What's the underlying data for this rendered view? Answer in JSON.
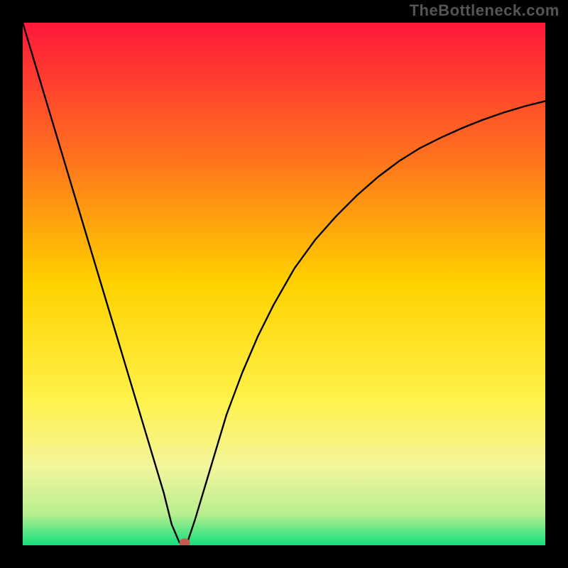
{
  "watermark": "TheBottleneck.com",
  "chart_data": {
    "type": "line",
    "title": "",
    "xlabel": "",
    "ylabel": "",
    "xlim": [
      0,
      100
    ],
    "ylim": [
      0,
      100
    ],
    "x": [
      0,
      3,
      6,
      9,
      12,
      15,
      18,
      21,
      24,
      27,
      28.5,
      30,
      31.5,
      33,
      36,
      39,
      42,
      45,
      48,
      52,
      56,
      60,
      64,
      68,
      72,
      76,
      80,
      84,
      88,
      92,
      96,
      100
    ],
    "values": [
      100,
      90,
      80,
      70,
      60,
      50,
      40,
      30,
      20,
      10,
      4,
      0.5,
      0.5,
      5,
      15,
      25,
      33,
      40,
      46,
      53,
      58.5,
      63,
      67,
      70.5,
      73.5,
      76,
      78,
      79.8,
      81.4,
      82.8,
      84,
      85
    ],
    "marker": {
      "x": 31,
      "y": 0.5
    },
    "background_gradient": {
      "stops": [
        {
          "offset": 0.0,
          "color": "#ff183b"
        },
        {
          "offset": 0.25,
          "color": "#ff6f1f"
        },
        {
          "offset": 0.5,
          "color": "#ffd200"
        },
        {
          "offset": 0.72,
          "color": "#fff24a"
        },
        {
          "offset": 0.85,
          "color": "#f3f59c"
        },
        {
          "offset": 0.94,
          "color": "#b9ef8f"
        },
        {
          "offset": 1.0,
          "color": "#12e07d"
        }
      ]
    }
  }
}
